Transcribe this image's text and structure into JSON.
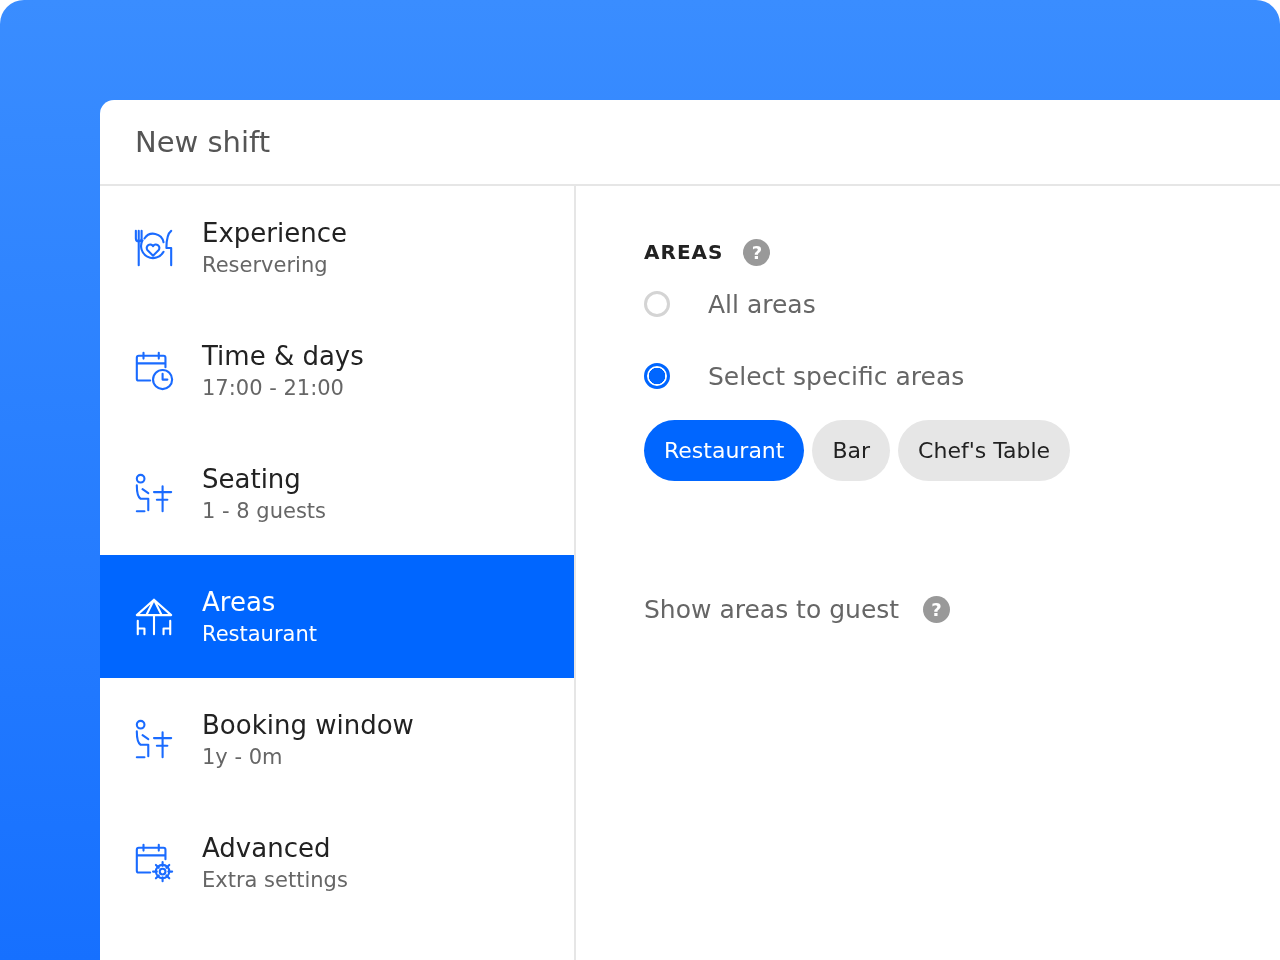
{
  "dialog": {
    "title": "New shift"
  },
  "steps": [
    {
      "kind": "dining",
      "title": "Experience",
      "subtitle": "Reservering",
      "selected": false
    },
    {
      "kind": "calendar-clock",
      "title": "Time & days",
      "subtitle": "17:00 - 21:00",
      "selected": false
    },
    {
      "kind": "seating",
      "title": "Seating",
      "subtitle": "1 - 8 guests",
      "selected": false
    },
    {
      "kind": "umbrella",
      "title": "Areas",
      "subtitle": "Restaurant",
      "selected": true
    },
    {
      "kind": "seating",
      "title": "Booking window",
      "subtitle": "1y - 0m",
      "selected": false
    },
    {
      "kind": "calendar-gear",
      "title": "Advanced",
      "subtitle": "Extra settings",
      "selected": false
    }
  ],
  "areas": {
    "heading": "AREAS",
    "help": "?",
    "options": [
      {
        "label": "All areas",
        "selected": false
      },
      {
        "label": "Select specific areas",
        "selected": true
      }
    ],
    "chips": [
      {
        "label": "Restaurant",
        "selected": true
      },
      {
        "label": "Bar",
        "selected": false
      },
      {
        "label": "Chef's Table",
        "selected": false
      }
    ],
    "show_to_guest": {
      "label": "Show areas to guest",
      "help": "?"
    }
  }
}
